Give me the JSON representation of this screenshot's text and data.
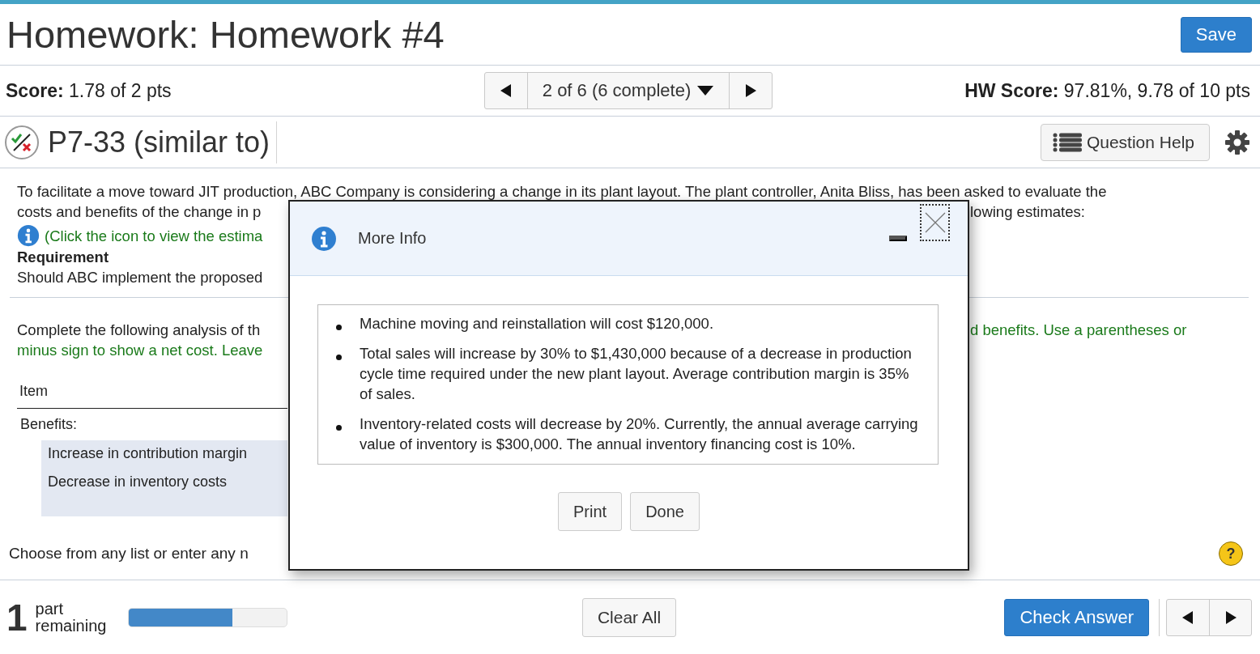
{
  "header": {
    "title": "Homework: Homework #4",
    "save_button": "Save"
  },
  "score_bar": {
    "score": "**Score:** 1.78 of 2 pts",
    "question_picker": "2 of 6 (6 complete)",
    "hw_score": "**HW Score:** 97.81%, 9.78 of 10 pts"
  },
  "question": {
    "title": "P7-33 (similar to)",
    "help_button": "Question Help"
  },
  "intro_lines": [
    {
      "segments": [
        {
          "kind": "plain",
          "text": "To facilitate a move toward JIT production, ABC Company is considering a change in its plant layout. The plant controller, Anita Bliss, has been asked to evaluate the"
        }
      ]
    },
    {
      "segments": [
        {
          "kind": "plain",
          "text": "costs and benefits of the change in p"
        },
        {
          "kind": "plain",
          "text": "lowing estimates:"
        }
      ]
    },
    {
      "segments": [
        {
          "kind": "info_note",
          "text": "(Click the icon to view the estima"
        }
      ]
    },
    {
      "segments": [
        {
          "kind": "heading",
          "text": "Requirement"
        }
      ]
    },
    {
      "segments": [
        {
          "kind": "plain",
          "text": "Should ABC implement the proposed"
        }
      ]
    }
  ],
  "task_lines": [
    {
      "segments": [
        {
          "kind": "plain",
          "text": "Complete the following analysis of th"
        },
        {
          "kind": "note",
          "text": "d benefits. Use a parentheses or"
        }
      ]
    },
    {
      "segments": [
        {
          "kind": "note",
          "text": "minus sign to show a net cost. Leave"
        }
      ]
    }
  ],
  "table": {
    "header": "Item",
    "group": "Benefits:",
    "rows": [
      "Increase in contribution margin",
      "Decrease in inventory costs"
    ]
  },
  "hint": "Choose from any list or enter any n",
  "help_mark": "?",
  "footer": {
    "remaining_count": "1",
    "remaining_label": "part remaining",
    "progress": {
      "level": 0.66
    },
    "clear_button": "Clear All",
    "check_button": "Check Answer"
  },
  "modal": {
    "title": "More Info",
    "bullets": [
      "Machine moving and reinstallation will cost $120,000.",
      "Total sales will increase by 30% to $1,430,000 because of a decrease in production cycle time required under the new plant layout. Average contribution margin is 35% of sales.",
      "Inventory-related costs will decrease by 20%. Currently, the annual average carrying value of inventory is $300,000. The annual inventory financing cost is 10%."
    ],
    "buttons": [
      "Print",
      "Done"
    ]
  }
}
